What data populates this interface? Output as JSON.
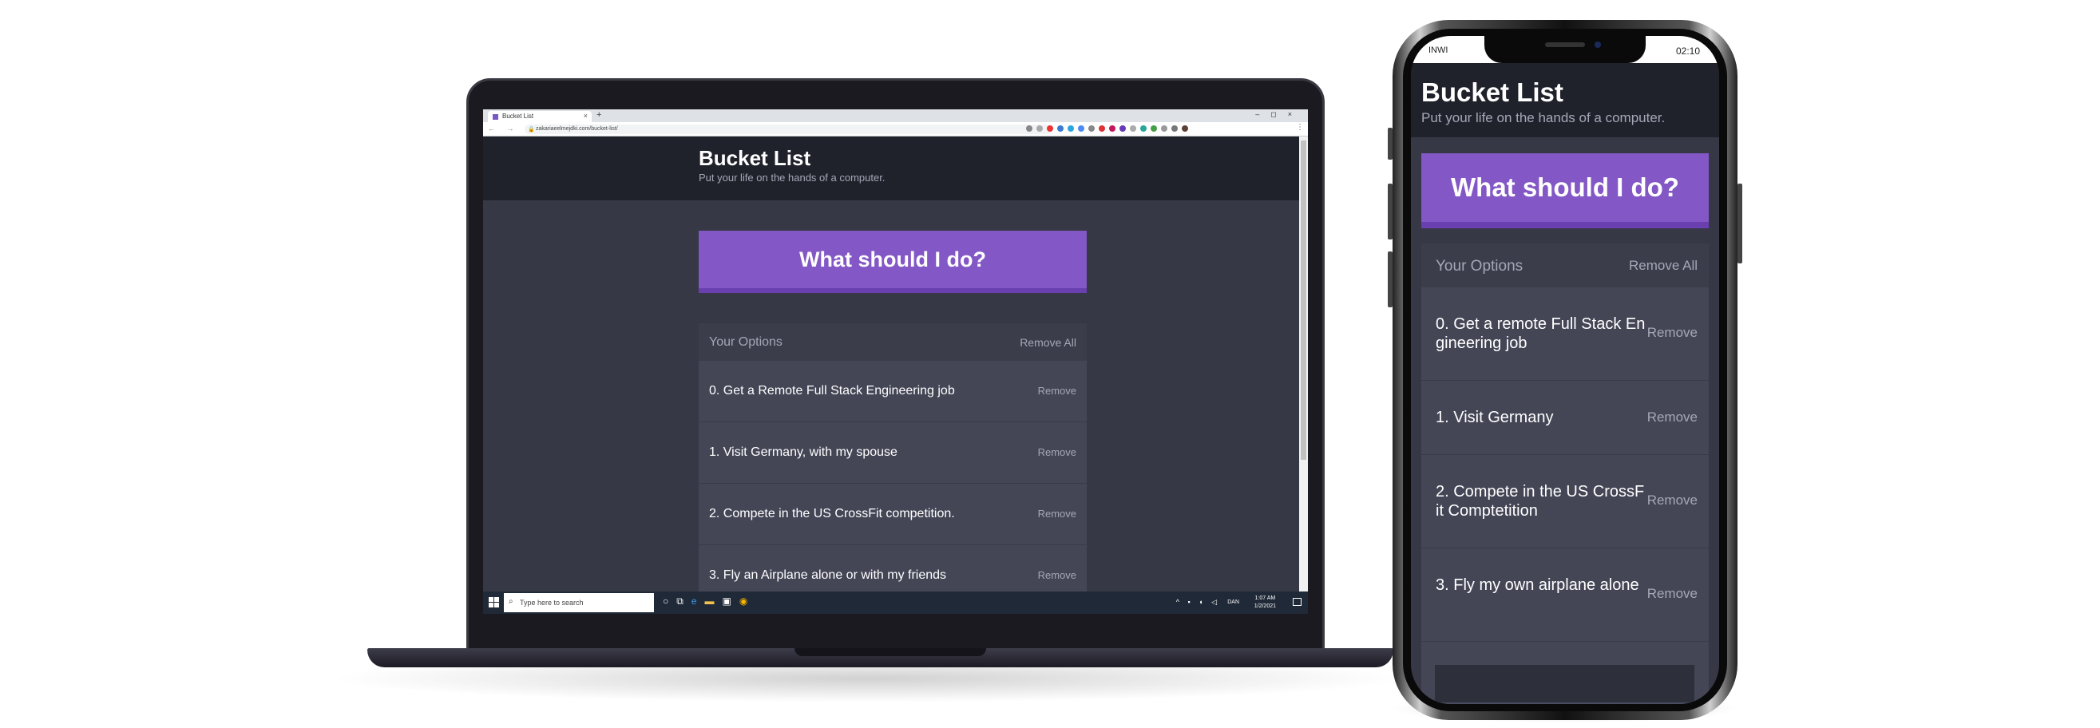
{
  "laptop": {
    "browser": {
      "tab_title": "Bucket List",
      "new_tab": "+",
      "window_controls": "–◻×",
      "url": "zakariaeelmejdki.com/bucket-list/",
      "nav": "← → C",
      "menu": "⋮"
    },
    "app": {
      "title": "Bucket List",
      "subtitle": "Put your life on the hands of a computer.",
      "action_button": "What should I do?",
      "options_header": "Your Options",
      "remove_all": "Remove All",
      "options": [
        {
          "text": "0. Get a Remote Full Stack Engineering job",
          "remove": "Remove"
        },
        {
          "text": "1. Visit Germany, with my spouse",
          "remove": "Remove"
        },
        {
          "text": "2. Compete in the US CrossFit competition.",
          "remove": "Remove"
        },
        {
          "text": "3. Fly an Airplane alone or with my friends",
          "remove": "Remove"
        }
      ]
    },
    "taskbar": {
      "search_placeholder": "Type here to search",
      "tray_icons": "^ ▪ ◖ ◁",
      "language": "DAN",
      "time": "1:07 AM",
      "date": "1/2/2021"
    }
  },
  "phone": {
    "status": {
      "carrier": "INWI",
      "time": "02:10"
    },
    "app": {
      "title": "Bucket List",
      "subtitle": "Put your life on the hands of a computer.",
      "action_button": "What should I do?",
      "options_header": "Your Options",
      "remove_all": "Remove All",
      "options": [
        {
          "text": "0. Get a remote Full Stack Engineering job",
          "remove": "Remove"
        },
        {
          "text": "1. Visit Germany",
          "remove": "Remove"
        },
        {
          "text": "2. Compete in the US CrossFit Comptetition",
          "remove": "Remove"
        },
        {
          "text": "3. Fly my own airplane alone",
          "remove": "Remove"
        }
      ]
    }
  },
  "colors": {
    "accent": "#8357c5",
    "header_bg": "#20222b",
    "body_bg": "#363845",
    "panel_bg": "#444656",
    "muted_text": "#a5a7b8"
  }
}
